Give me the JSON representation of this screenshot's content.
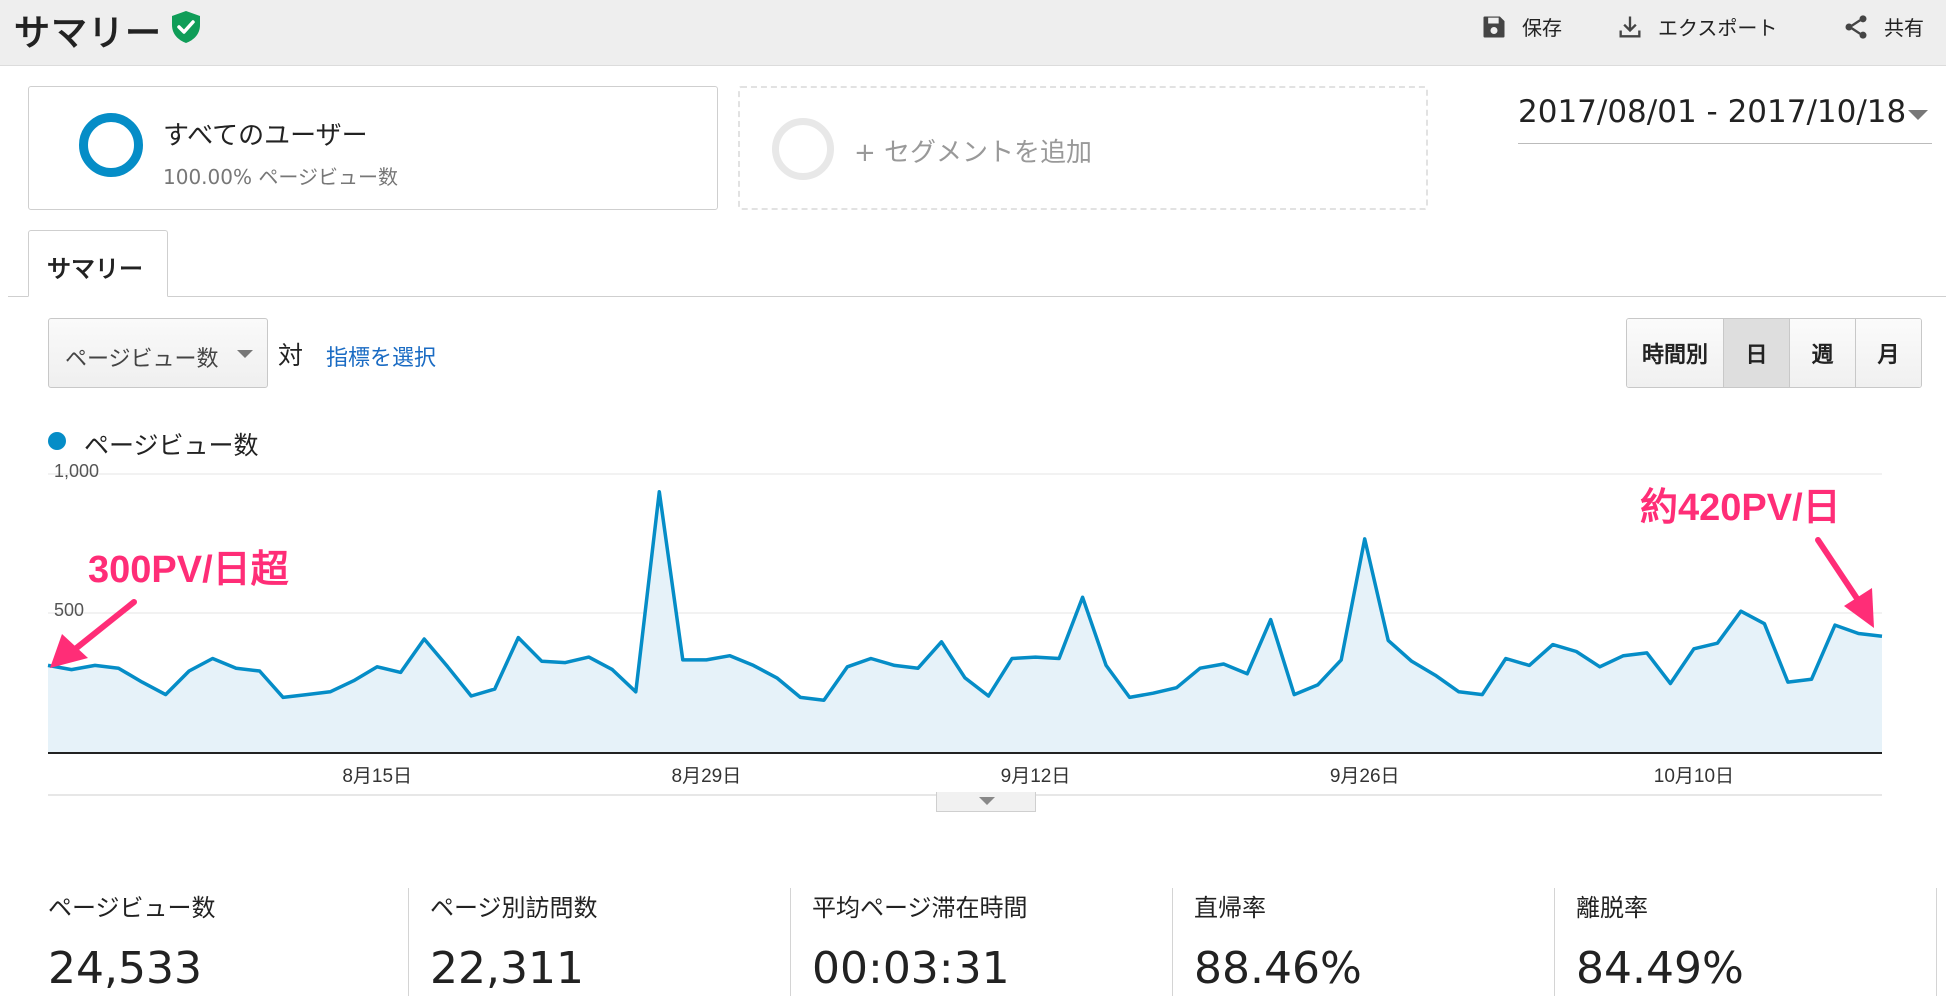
{
  "header": {
    "title": "サマリー",
    "save_label": "保存",
    "export_label": "エクスポート",
    "share_label": "共有"
  },
  "segments": {
    "all_users_title": "すべてのユーザー",
    "all_users_sub": "100.00% ページビュー数",
    "add_segment_label": "+ セグメントを追加"
  },
  "date_range": "2017/08/01 - 2017/10/18",
  "tabs": [
    {
      "label": "サマリー",
      "active": true
    }
  ],
  "controls": {
    "metric_select_value": "ページビュー数",
    "versus_label": "対",
    "pick_metric_link": "指標を選択",
    "granularity": [
      {
        "label": "時間別",
        "active": false
      },
      {
        "label": "日",
        "active": true
      },
      {
        "label": "週",
        "active": false
      },
      {
        "label": "月",
        "active": false
      }
    ]
  },
  "legend": {
    "label": "ページビュー数",
    "color": "#058dc7"
  },
  "chart_data": {
    "type": "area",
    "series": [
      {
        "name": "ページビュー数",
        "color": "#058dc7",
        "values": [
          315,
          300,
          315,
          305,
          255,
          210,
          295,
          340,
          305,
          295,
          200,
          210,
          220,
          260,
          310,
          290,
          410,
          310,
          205,
          230,
          415,
          330,
          325,
          345,
          300,
          220,
          940,
          335,
          335,
          350,
          315,
          270,
          200,
          190,
          310,
          340,
          315,
          305,
          400,
          270,
          205,
          340,
          345,
          340,
          560,
          315,
          200,
          215,
          235,
          305,
          320,
          285,
          480,
          210,
          245,
          335,
          770,
          405,
          330,
          280,
          220,
          210,
          340,
          315,
          390,
          365,
          310,
          350,
          360,
          250,
          375,
          395,
          510,
          465,
          255,
          265,
          460,
          430,
          420
        ]
      }
    ],
    "x_tick_labels": [
      "8月15日",
      "8月29日",
      "9月12日",
      "9月26日",
      "10月10日"
    ],
    "y_tick_labels": [
      "1,000",
      "500"
    ],
    "ylim": [
      0,
      1000
    ],
    "grid": true,
    "annotations": [
      {
        "text": "300PV/日超",
        "color": "#ff2d77"
      },
      {
        "text": "約420PV/日",
        "color": "#ff2d77"
      }
    ]
  },
  "stats": [
    {
      "label": "ページビュー数",
      "value": "24,533"
    },
    {
      "label": "ページ別訪問数",
      "value": "22,311"
    },
    {
      "label": "平均ページ滞在時間",
      "value": "00:03:31"
    },
    {
      "label": "直帰率",
      "value": "88.46%"
    },
    {
      "label": "離脱率",
      "value": "84.49%"
    }
  ]
}
